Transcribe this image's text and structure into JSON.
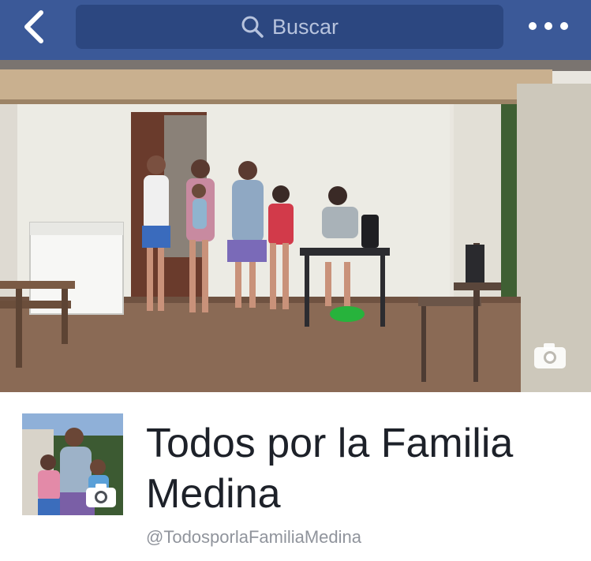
{
  "navbar": {
    "back_icon": "chevron-left-icon",
    "search": {
      "placeholder": "Buscar",
      "icon": "search-icon"
    },
    "more_icon": "more-dots-icon",
    "color": "#3b5998"
  },
  "cover": {
    "camera_icon": "camera-icon"
  },
  "page": {
    "title": "Todos por la Familia Medina",
    "handle": "@TodosporlaFamiliaMedina",
    "profile_camera_icon": "camera-icon"
  }
}
